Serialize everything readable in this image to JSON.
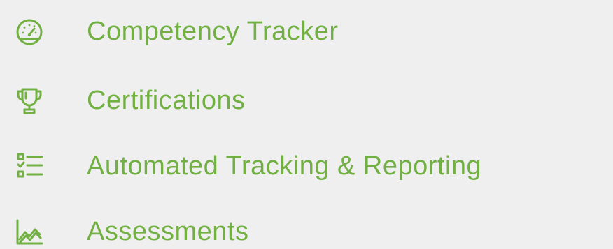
{
  "colors": {
    "accent": "#72b043",
    "background": "#efefef"
  },
  "menu": {
    "items": [
      {
        "label": "Competency Tracker",
        "icon": "speedometer-icon"
      },
      {
        "label": "Certifications",
        "icon": "trophy-icon"
      },
      {
        "label": "Automated Tracking & Reporting",
        "icon": "checklist-icon"
      },
      {
        "label": "Assessments",
        "icon": "line-chart-icon"
      }
    ]
  }
}
